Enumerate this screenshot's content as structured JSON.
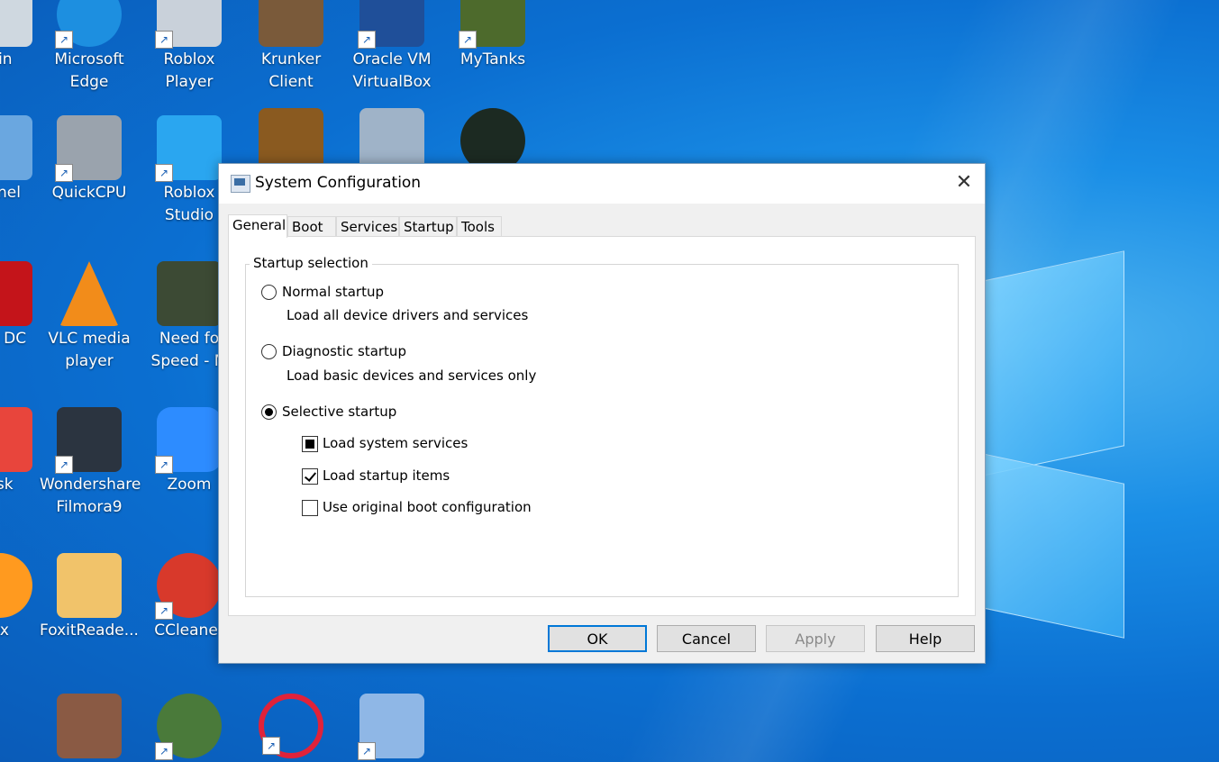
{
  "desktop": {
    "icons": [
      {
        "label": "Bin"
      },
      {
        "label": "Microsoft Edge"
      },
      {
        "label": "Roblox Player"
      },
      {
        "label": "Krunker Client"
      },
      {
        "label": "Oracle VM VirtualBox"
      },
      {
        "label": "MyTanks"
      },
      {
        "label": "Panel"
      },
      {
        "label": "QuickCPU"
      },
      {
        "label": "Roblox Studio"
      },
      {
        "label": "bat DC"
      },
      {
        "label": "VLC media player"
      },
      {
        "label": "Need fo Speed - M"
      },
      {
        "label": "esk"
      },
      {
        "label": "Wondershare Filmora9"
      },
      {
        "label": "Zoom"
      },
      {
        "label": "ox"
      },
      {
        "label": "FoxitReade..."
      },
      {
        "label": "CCleaner"
      }
    ]
  },
  "dialog": {
    "title": "System Configuration",
    "close_glyph": "✕",
    "tabs": [
      {
        "label": "General",
        "active": true
      },
      {
        "label": "Boot"
      },
      {
        "label": "Services"
      },
      {
        "label": "Startup"
      },
      {
        "label": "Tools"
      }
    ],
    "group_label": "Startup selection",
    "options": {
      "normal": {
        "label": "Normal startup",
        "desc": "Load all device drivers and services",
        "selected": false
      },
      "diagnostic": {
        "label": "Diagnostic startup",
        "desc": "Load basic devices and services only",
        "selected": false
      },
      "selective": {
        "label": "Selective startup",
        "selected": true
      }
    },
    "checkboxes": {
      "load_system_services": {
        "label": "Load system services",
        "state": "indeterminate"
      },
      "load_startup_items": {
        "label": "Load startup items",
        "state": "checked"
      },
      "use_original_boot": {
        "label": "Use original boot configuration",
        "state": "unchecked"
      }
    },
    "buttons": {
      "ok": "OK",
      "cancel": "Cancel",
      "apply": "Apply",
      "help": "Help"
    }
  }
}
